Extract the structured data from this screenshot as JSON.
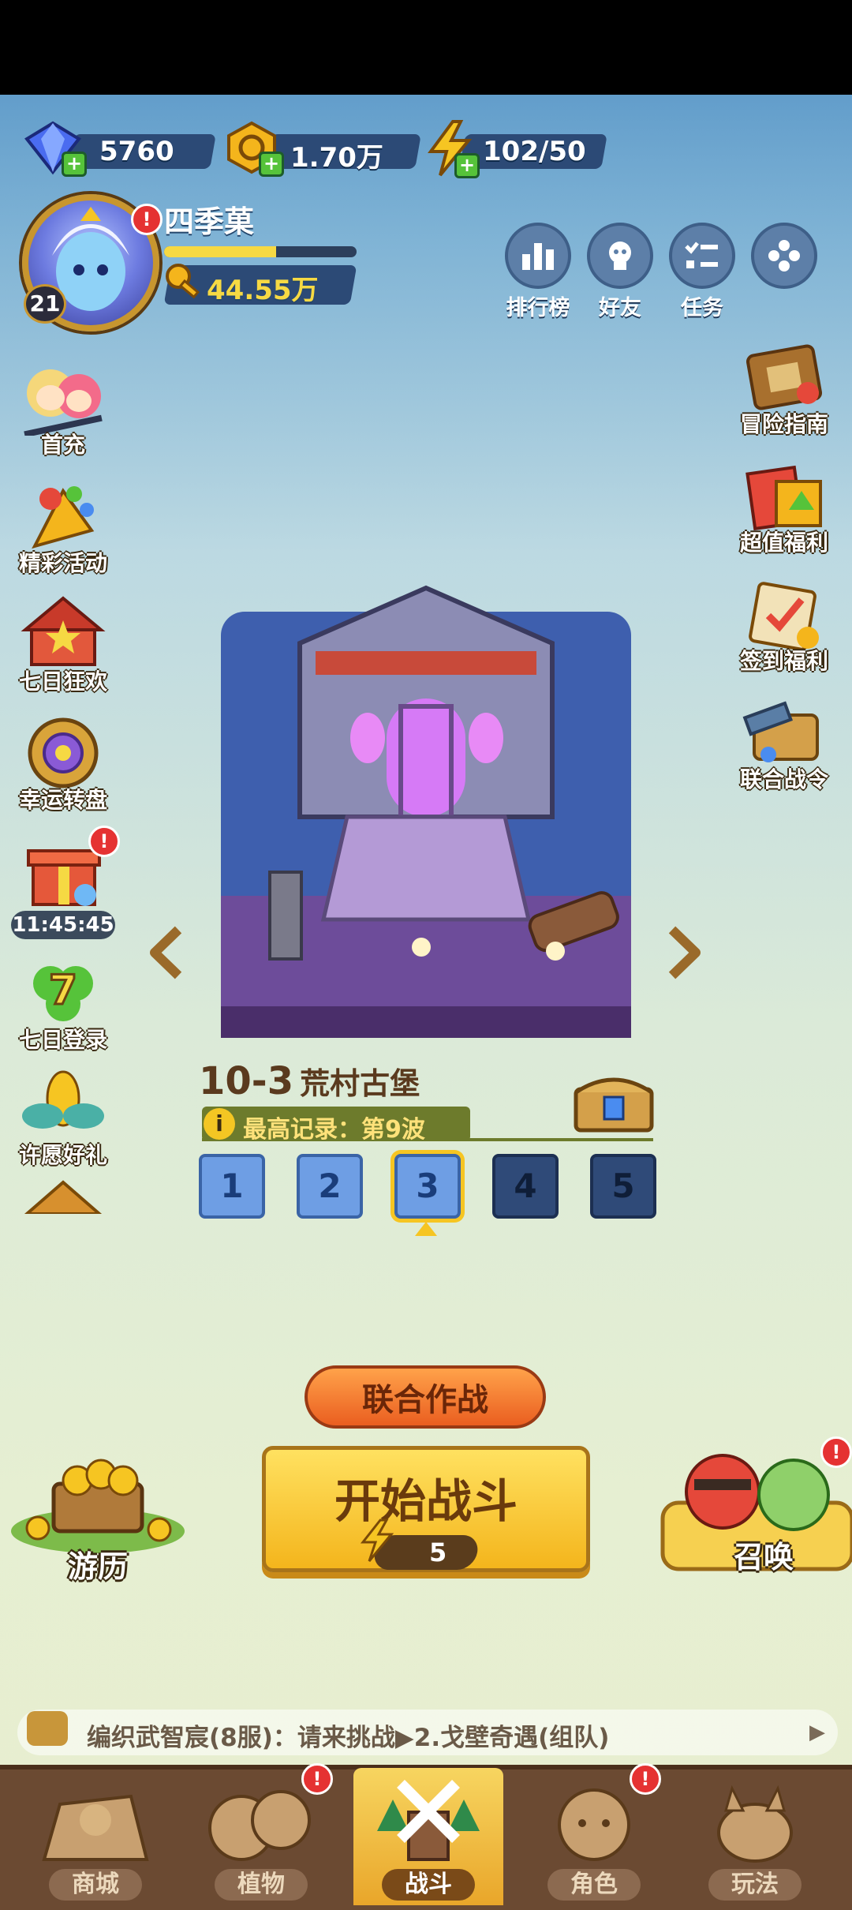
{
  "resources": {
    "gems": "5760",
    "gold": "1.70万",
    "energy": "102/50"
  },
  "profile": {
    "name": "四季菓",
    "level": "21",
    "xp_fraction": 0.58,
    "coins": "44.55万",
    "alert": "!"
  },
  "top_buttons": [
    "排行榜",
    "好友",
    "任务"
  ],
  "left_events": [
    "首充",
    "精彩活动",
    "七日狂欢",
    "幸运转盘",
    "七日登录",
    "许愿好礼"
  ],
  "left_timer": "11:45:45",
  "right_events": [
    "冒险指南",
    "超值福利",
    "签到福利",
    "联合战令"
  ],
  "stage": {
    "number": "10-3",
    "name": "荒村古堡",
    "record": "最高记录：第9波",
    "waves": [
      "1",
      "2",
      "3",
      "4",
      "5"
    ],
    "selected_wave": "3"
  },
  "actions": {
    "coop": "联合作战",
    "start": "开始战斗",
    "start_cost": "5",
    "travel": "游历",
    "summon": "召唤"
  },
  "chat": {
    "message": "编织武智宸(8服)：请来挑战▶2.戈壁奇遇(组队)",
    "more": "▶"
  },
  "nav": [
    "商城",
    "植物",
    "战斗",
    "角色",
    "玩法"
  ],
  "nav_active": "战斗",
  "colors": {
    "gold": "#f6d943",
    "button_yellow": "#f4b51c",
    "button_orange": "#ea5e20",
    "nav_brown": "#6b4a32",
    "badge_red": "#e53232"
  }
}
